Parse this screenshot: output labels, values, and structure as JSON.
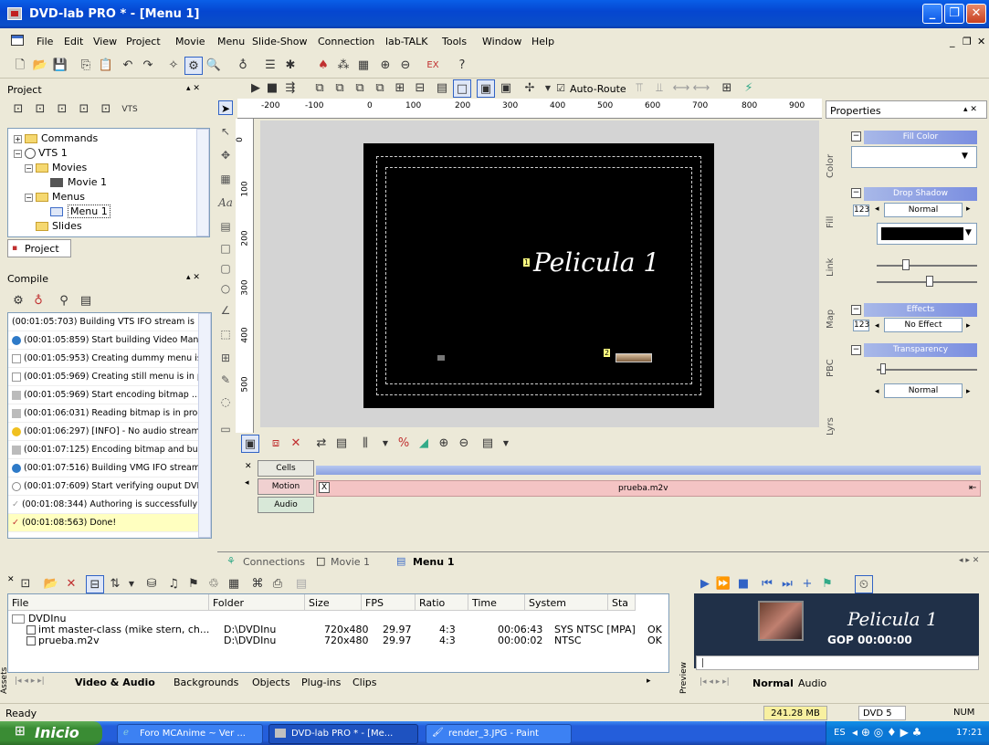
{
  "window": {
    "title": "DVD-lab PRO * - [Menu 1]"
  },
  "menu": [
    "File",
    "Edit",
    "View",
    "Project",
    "Movie",
    "Menu",
    "Slide-Show",
    "Connection",
    "lab-TALK",
    "Tools",
    "Window",
    "Help"
  ],
  "toolbar": {
    "auto_route": "Auto-Route"
  },
  "project_panel": {
    "title": "Project",
    "tree": [
      "Commands",
      "VTS 1",
      "Movies",
      "Movie 1",
      "Menus",
      "Menu 1",
      "Slides"
    ],
    "tab": "Project"
  },
  "compile_panel": {
    "title": "Compile",
    "log": [
      "(00:01:05:703) Building VTS IFO stream is",
      "(00:01:05:859) Start building Video Manage",
      "(00:01:05:953) Creating dummy menu is ir",
      "(00:01:05:969) Creating still menu is in pro",
      "(00:01:05:969) Start encoding bitmap ...",
      "(00:01:06:031) Reading bitmap is in proces",
      "(00:01:06:297) [INFO] - No audio stream is",
      "(00:01:07:125) Encoding bitmap and buildir",
      "(00:01:07:516) Building VMG IFO stream is",
      "(00:01:07:609) Start verifying ouput DVD",
      "(00:01:08:344) Authoring is successfully c",
      "(00:01:08:563) Done!"
    ]
  },
  "ruler": {
    "h": [
      "-200",
      "-100",
      "0",
      "100",
      "200",
      "300",
      "400",
      "500",
      "600",
      "700",
      "800",
      "900"
    ],
    "v": [
      "0",
      "100",
      "200",
      "300",
      "400",
      "500"
    ]
  },
  "canvas": {
    "menu_text": "Pelicula 1",
    "marker1": "1",
    "marker2": "2"
  },
  "properties": {
    "title": "Properties",
    "tabs": [
      "Color",
      "Fill",
      "Link",
      "Map",
      "PBC",
      "Lyrs"
    ],
    "fill_color": "Fill Color",
    "drop_shadow": "Drop Shadow",
    "shadow_mode": "Normal",
    "effects": "Effects",
    "effect_value": "No Effect",
    "transparency": "Transparency",
    "transparency_mode": "Normal",
    "num_badge": "123"
  },
  "timeline": {
    "rows": [
      "Cells",
      "Motion",
      "Audio"
    ],
    "clip": "prueba.m2v",
    "clip_marker": "X"
  },
  "doc_tabs": {
    "connections": "Connections",
    "movie": "Movie 1",
    "menu": "Menu 1"
  },
  "assets": {
    "side_label": "Assets",
    "columns": [
      "File",
      "Folder",
      "Size",
      "FPS",
      "Ratio",
      "Time",
      "System",
      "Sta"
    ],
    "folder_row": "DVDInu",
    "rows": [
      [
        "imt master-class (mike stern, ch...",
        "D:\\DVDInu",
        "720x480",
        "29.97",
        "4:3",
        "00:06:43",
        "SYS NTSC [MPA]",
        "OK"
      ],
      [
        "prueba.m2v",
        "D:\\DVDInu",
        "720x480",
        "29.97",
        "4:3",
        "00:00:02",
        "NTSC",
        "OK"
      ]
    ],
    "tabs": [
      "Video & Audio",
      "Backgrounds",
      "Objects",
      "Plug-ins",
      "Clips"
    ]
  },
  "preview": {
    "side_label": "Preview",
    "title": "Pelicula 1",
    "gop": "GOP 00:00:00",
    "tabs": [
      "Normal",
      "Audio"
    ]
  },
  "status": {
    "text": "Ready",
    "memory": "241.28 MB",
    "dvd": "DVD 5",
    "num": "NUM"
  },
  "taskbar": {
    "start": "Inicio",
    "items": [
      "Foro MCAnime ~ Ver ...",
      "DVD-lab PRO * - [Me...",
      "render_3.JPG - Paint"
    ],
    "lang": "ES",
    "clock": "17:21"
  }
}
